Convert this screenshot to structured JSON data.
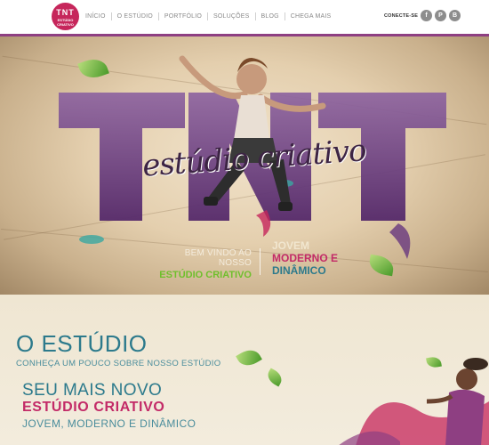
{
  "logo": {
    "line1": "TNT",
    "line2": "ESTÚDIO CRIATIVO"
  },
  "nav": {
    "items": [
      "INÍCIO",
      "O ESTÚDIO",
      "PORTFÓLIO",
      "SOLUÇÕES",
      "BLOG",
      "CHEGA MAIS"
    ]
  },
  "social": {
    "label": "CONECTE-SE",
    "icons": [
      "facebook-icon",
      "pinterest-icon",
      "blogger-icon"
    ]
  },
  "hero": {
    "big_letters": "TNT",
    "script_text": "estúdio criativo",
    "welcome_line1": "BEM VINDO AO NOSSO",
    "welcome_line2": "ESTÚDIO CRIATIVO",
    "tag_line1": "JOVEM",
    "tag_line2": "MODERNO E",
    "tag_line3": "DINÂMICO"
  },
  "section": {
    "title": "O ESTÚDIO",
    "subtitle": "CONHEÇA UM POUCO SOBRE NOSSO ESTÚDIO",
    "line1": "SEU MAIS NOVO",
    "line2": "ESTÚDIO CRIATIVO",
    "line3": "JOVEM, MODERNO E DINÂMICO"
  },
  "colors": {
    "brand_pink": "#c6265b",
    "purple": "#6b3d7c",
    "teal": "#2c7a8c",
    "green": "#6fbf2c"
  }
}
